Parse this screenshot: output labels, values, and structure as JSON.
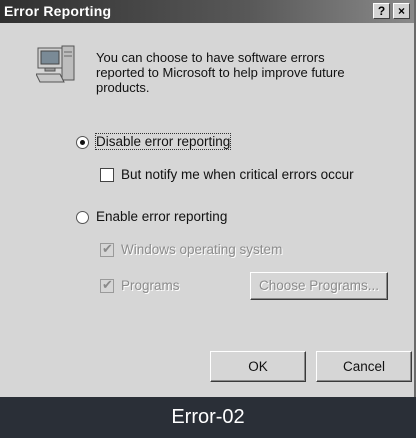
{
  "window": {
    "title": "Error Reporting",
    "help_label": "?",
    "close_label": "×"
  },
  "intro": "You can choose to have software errors reported to Microsoft to help improve future products.",
  "options": {
    "disable": {
      "label": "Disable error reporting",
      "selected": true
    },
    "notify": {
      "label": "But notify me when critical errors occur",
      "checked": false
    },
    "enable": {
      "label": "Enable error reporting",
      "selected": false
    },
    "windows_os": {
      "label": "Windows operating system",
      "checked": true,
      "enabled": false
    },
    "programs": {
      "label": "Programs",
      "checked": true,
      "enabled": false
    }
  },
  "buttons": {
    "choose_programs": "Choose Programs...",
    "ok": "OK",
    "cancel": "Cancel"
  },
  "caption": "Error-02",
  "icons": {
    "computer": "computer-icon"
  }
}
